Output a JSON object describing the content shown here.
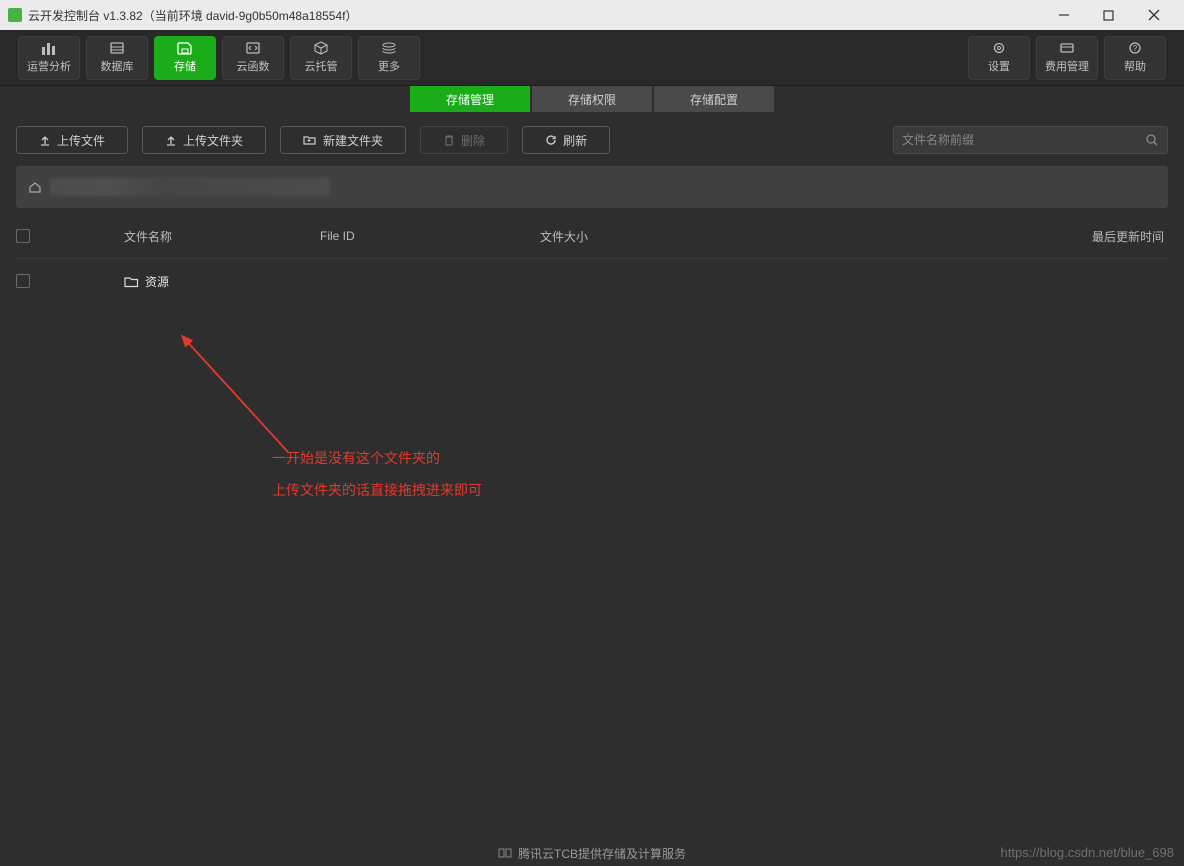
{
  "window": {
    "title": "云开发控制台 v1.3.82（当前环境 david-9g0b50m48a18554f）"
  },
  "nav": {
    "left": [
      {
        "label": "运营分析"
      },
      {
        "label": "数据库"
      },
      {
        "label": "存储",
        "active": true
      },
      {
        "label": "云函数"
      },
      {
        "label": "云托管"
      },
      {
        "label": "更多"
      }
    ],
    "right": [
      {
        "label": "设置"
      },
      {
        "label": "费用管理"
      },
      {
        "label": "帮助"
      }
    ]
  },
  "subtabs": [
    {
      "label": "存储管理",
      "active": true
    },
    {
      "label": "存储权限"
    },
    {
      "label": "存储配置"
    }
  ],
  "toolbar": {
    "upload_file": "上传文件",
    "upload_folder": "上传文件夹",
    "new_folder": "新建文件夹",
    "delete": "删除",
    "refresh": "刷新"
  },
  "search": {
    "placeholder": "文件名称前缀"
  },
  "table": {
    "headers": {
      "name": "文件名称",
      "file_id": "File ID",
      "size": "文件大小",
      "updated": "最后更新时间"
    },
    "rows": [
      {
        "name": "资源",
        "type": "folder"
      }
    ]
  },
  "annotations": {
    "line1": "一开始是没有这个文件夹的",
    "line2": "上传文件夹的话直接拖拽进来即可"
  },
  "footer": {
    "text": "腾讯云TCB提供存储及计算服务"
  },
  "watermark": "https://blog.csdn.net/blue_698"
}
